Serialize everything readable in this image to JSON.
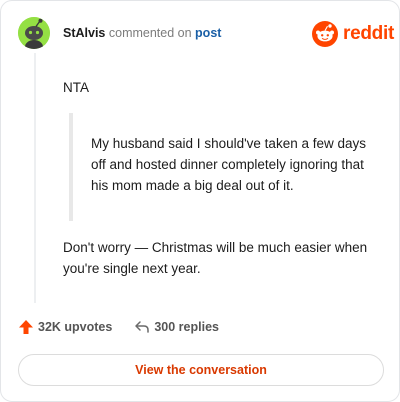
{
  "header": {
    "username": "StAlvis",
    "action_text": "commented on",
    "post_link": "post",
    "brand": "reddit"
  },
  "comment": {
    "text": "NTA",
    "quote": "My husband said I should've taken a few days off and hosted dinner completely ignoring that his mom made a big deal out of it.",
    "reply": "Don't worry — Christmas will be much easier when you're single next year."
  },
  "actions": {
    "upvotes": "32K upvotes",
    "replies": "300 replies"
  },
  "cta": {
    "label": "View the conversation"
  },
  "colors": {
    "brand": "#ff4500",
    "avatar_bg": "#94e044",
    "link": "#1a5fa6"
  }
}
